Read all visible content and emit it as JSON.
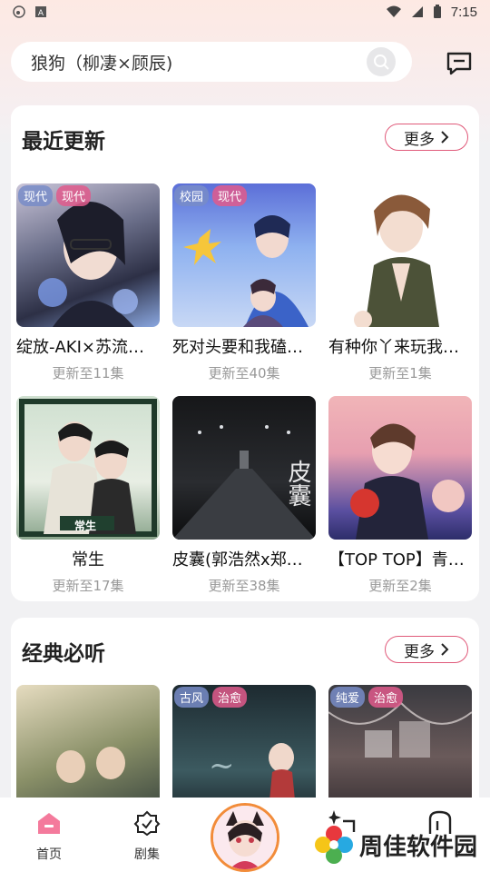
{
  "status": {
    "time": "7:15"
  },
  "search": {
    "query": "狼狗（柳凄×顾辰)"
  },
  "recent": {
    "title": "最近更新",
    "more": "更多",
    "items": [
      {
        "title": "绽放-AKI×苏流…",
        "sub": "更新至11集",
        "tags": [
          "现代",
          "现代"
        ]
      },
      {
        "title": "死对头要和我磕…",
        "sub": "更新至40集",
        "tags": [
          "校园",
          "现代"
        ]
      },
      {
        "title": "有种你丫来玩我…",
        "sub": "更新至1集",
        "tags": []
      },
      {
        "title": "常生",
        "sub": "更新至17集",
        "tags": []
      },
      {
        "title": "皮囊(郭浩然x郑…",
        "sub": "更新至38集",
        "tags": []
      },
      {
        "title": "【TOP TOP】青…",
        "sub": "更新至2集",
        "tags": []
      }
    ]
  },
  "classic": {
    "title": "经典必听",
    "more": "更多",
    "items": [
      {
        "tags": []
      },
      {
        "tags": [
          "古风",
          "治愈"
        ]
      },
      {
        "tags": [
          "纯爱",
          "治愈"
        ]
      }
    ]
  },
  "tabs": [
    {
      "label": "首页",
      "icon": "home-icon",
      "active": true
    },
    {
      "label": "剧集",
      "icon": "drama-icon",
      "active": false
    }
  ],
  "cover_art": {
    "c1": "常生",
    "c2": "皮囊"
  },
  "watermark": "周佳软件园",
  "colors": {
    "accent": "#e05a7a",
    "avatar_ring": "#f28c3a"
  }
}
